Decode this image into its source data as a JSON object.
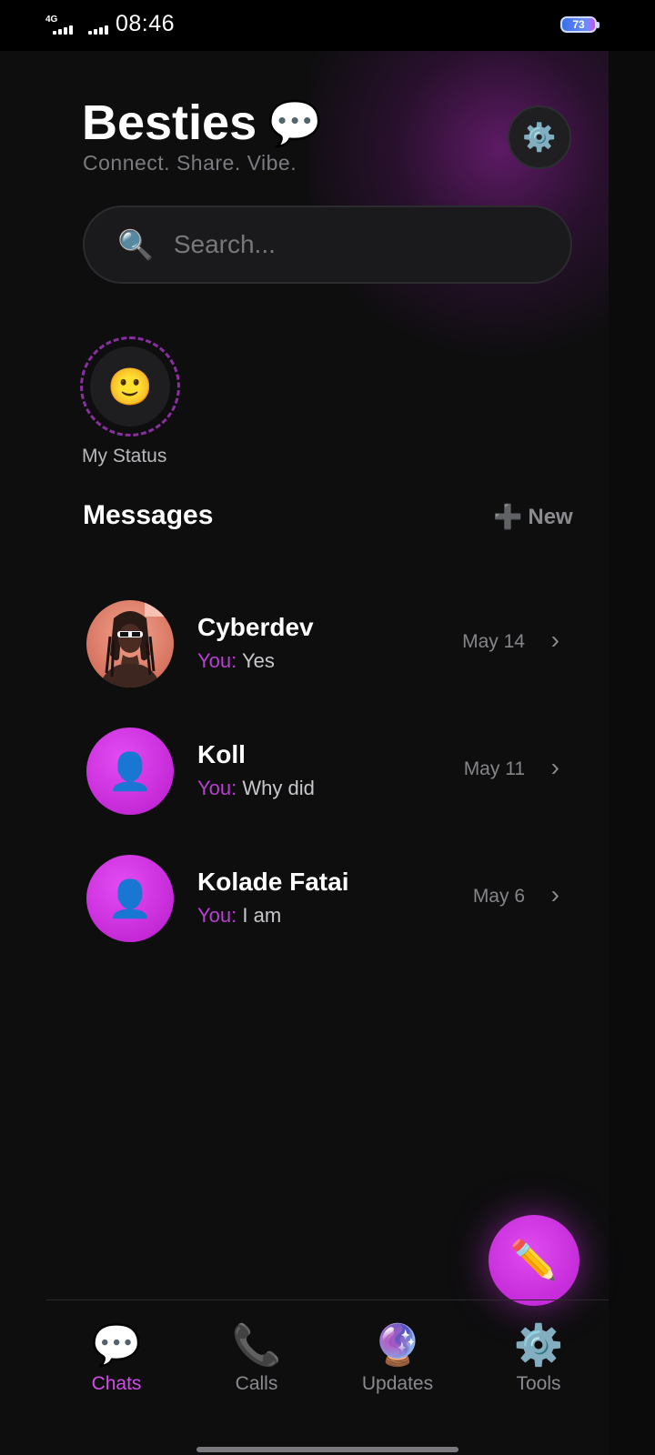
{
  "statusbar": {
    "network": "4G",
    "time": "08:46",
    "battery": "73"
  },
  "header": {
    "title": "Besties",
    "subtitle": "Connect. Share. Vibe.",
    "settings_icon": "gear-icon"
  },
  "search": {
    "placeholder": "Search..."
  },
  "status": {
    "label": "My Status"
  },
  "messages": {
    "title": "Messages",
    "new_label": "New",
    "chats": [
      {
        "name": "Cyberdev",
        "prefix": "You:",
        "preview": "Yes",
        "date": "May 14",
        "avatar": "photo"
      },
      {
        "name": "Koll",
        "prefix": "You:",
        "preview": "Why did",
        "date": "May 11",
        "avatar": "person-icon"
      },
      {
        "name": "Kolade Fatai",
        "prefix": "You:",
        "preview": "I am",
        "date": "May 6",
        "avatar": "person-icon"
      }
    ]
  },
  "nav": {
    "items": [
      {
        "label": "Chats",
        "icon": "chat-bubble-icon",
        "active": true
      },
      {
        "label": "Calls",
        "icon": "phone-icon",
        "active": false
      },
      {
        "label": "Updates",
        "icon": "crystal-ball-icon",
        "active": false
      },
      {
        "label": "Tools",
        "icon": "gear-icon",
        "active": false
      }
    ]
  },
  "colors": {
    "accent": "#c62ad8",
    "background": "#0e0e0f",
    "you_prefix": "#b83fd0"
  }
}
